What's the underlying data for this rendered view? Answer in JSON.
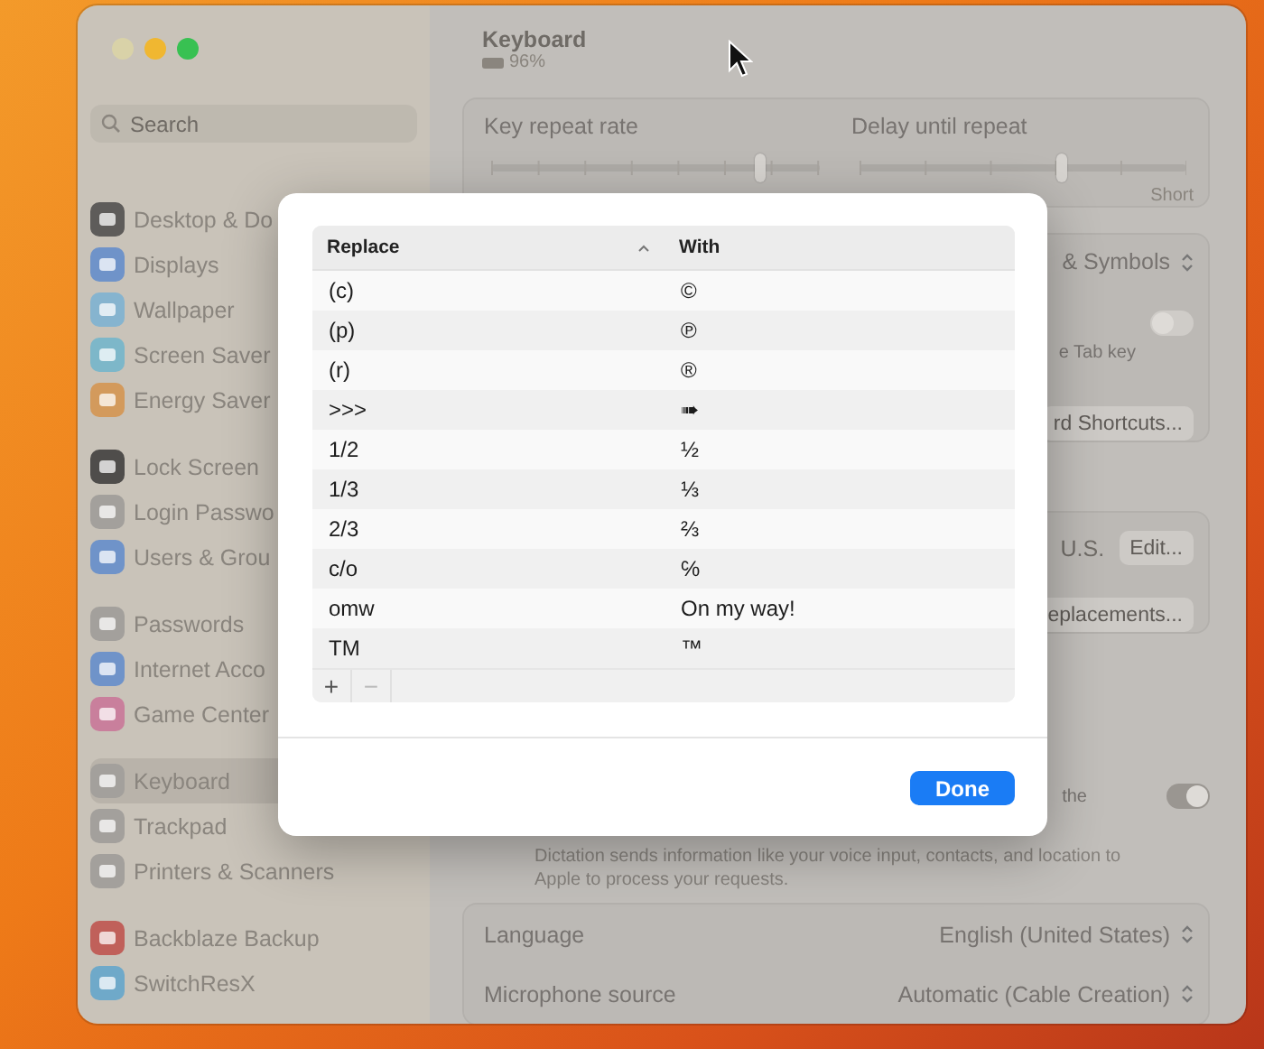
{
  "window": {
    "title": "Keyboard",
    "battery": "96%"
  },
  "sidebar": {
    "search": {
      "placeholder": "Search"
    },
    "groups": [
      [
        {
          "label": "Desktop & Do",
          "color": "#5e5c5a",
          "selected": false
        },
        {
          "label": "Displays",
          "color": "#6f93c9",
          "selected": false
        },
        {
          "label": "Wallpaper",
          "color": "#86b4cf",
          "selected": false
        },
        {
          "label": "Screen Saver",
          "color": "#7db7c9",
          "selected": false
        },
        {
          "label": "Energy Saver",
          "color": "#d39a5c",
          "selected": false
        }
      ],
      [
        {
          "label": "Lock Screen",
          "color": "#4f4d4b",
          "selected": false
        },
        {
          "label": "Login Passwo",
          "color": "#a3a09c",
          "selected": false
        },
        {
          "label": "Users & Grou",
          "color": "#6f93c9",
          "selected": false
        }
      ],
      [
        {
          "label": "Passwords",
          "color": "#a3a09c",
          "selected": false
        },
        {
          "label": "Internet Acco",
          "color": "#6f93c9",
          "selected": false
        },
        {
          "label": "Game Center",
          "color": "#c97f9c",
          "selected": false
        }
      ],
      [
        {
          "label": "Keyboard",
          "color": "#a3a09c",
          "selected": true
        },
        {
          "label": "Trackpad",
          "color": "#a3a09c",
          "selected": false
        },
        {
          "label": "Printers & Scanners",
          "color": "#a3a09c",
          "selected": false
        }
      ],
      [
        {
          "label": "Backblaze  Backup",
          "color": "#c0605a",
          "selected": false
        },
        {
          "label": "SwitchResX",
          "color": "#6fa9c9",
          "selected": false
        }
      ]
    ]
  },
  "key_repeat": {
    "rate": {
      "label": "Key repeat rate",
      "level": 0.82
    },
    "delay": {
      "label": "Delay until repeat",
      "level": 0.62,
      "end_label": "Short"
    }
  },
  "input_card": {
    "popup": "& Symbols",
    "tab_hint": "e Tab key",
    "tab_toggle": {
      "on": false
    },
    "shortcuts_button": "rd Shortcuts..."
  },
  "text_input_card": {
    "source": "U.S.",
    "edit_button": "Edit...",
    "replacements_button": "eplacements..."
  },
  "dictation": {
    "hint": "the",
    "toggle": {
      "on": true
    },
    "note": "Dictation sends information like your voice input, contacts, and location to Apple to process your requests."
  },
  "dictation_settings": [
    {
      "label": "Language",
      "value": "English (United States)"
    },
    {
      "label": "Microphone source",
      "value": "Automatic (Cable Creation)"
    }
  ],
  "dialog": {
    "columns": [
      {
        "label": "Replace",
        "sorted": true
      },
      {
        "label": "With",
        "sorted": false
      }
    ],
    "rows": [
      {
        "replace": "(c)",
        "with": "©"
      },
      {
        "replace": "(p)",
        "with": "℗"
      },
      {
        "replace": "(r)",
        "with": "®"
      },
      {
        "replace": ">>>",
        "with": "➠"
      },
      {
        "replace": "1/2",
        "with": "½"
      },
      {
        "replace": "1/3",
        "with": "⅓"
      },
      {
        "replace": "2/3",
        "with": "⅔"
      },
      {
        "replace": "c/o",
        "with": "℅"
      },
      {
        "replace": "omw",
        "with": "On my way!"
      },
      {
        "replace": "TM",
        "with": "™"
      }
    ],
    "footer": {
      "add": "+",
      "remove": "−"
    },
    "done_button": "Done"
  }
}
